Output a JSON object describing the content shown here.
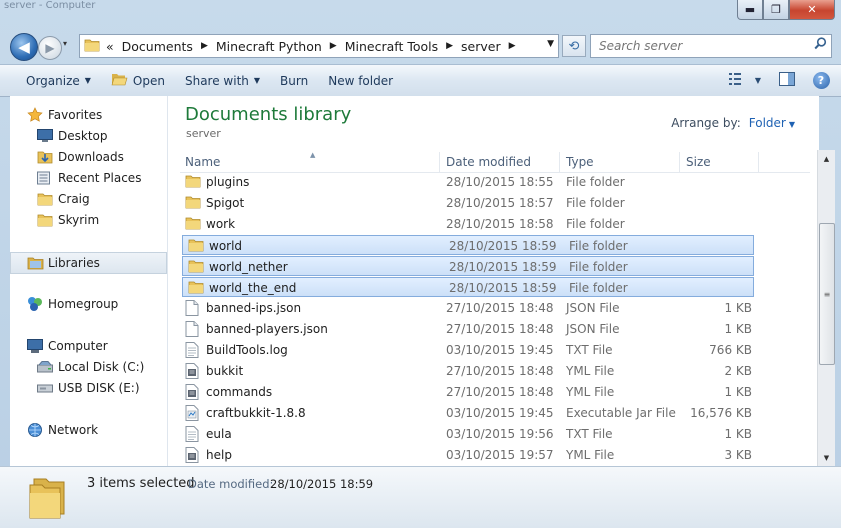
{
  "window": {
    "title": "server - Computer",
    "buttons": {
      "minimize": "▬",
      "maximize": "❐",
      "close": "✕"
    }
  },
  "nav": {
    "back_glyph": "◀",
    "forward_glyph": "▶",
    "history_glyph": "▾",
    "breadcrumb_prefix": "«",
    "breadcrumb": [
      "Documents",
      "Minecraft Python",
      "Minecraft Tools",
      "server"
    ],
    "refresh_glyph": "⟲",
    "search_placeholder": "Search server"
  },
  "toolbar": {
    "organize": "Organize",
    "open": "Open",
    "share_with": "Share with",
    "burn": "Burn",
    "new_folder": "New folder"
  },
  "sidebar": {
    "favorites": "Favorites",
    "favorites_items": [
      "Desktop",
      "Downloads",
      "Recent Places",
      "Craig",
      "Skyrim"
    ],
    "libraries": "Libraries",
    "homegroup": "Homegroup",
    "computer": "Computer",
    "computer_items": [
      "Local Disk (C:)",
      "USB DISK (E:)"
    ],
    "network": "Network"
  },
  "library": {
    "title": "Documents library",
    "subtitle": "server",
    "arrange_label": "Arrange by:",
    "arrange_value": "Folder"
  },
  "columns": {
    "name": "Name",
    "date": "Date modified",
    "type": "Type",
    "size": "Size"
  },
  "files": [
    {
      "name": "plugins",
      "date": "28/10/2015 18:55",
      "type": "File folder",
      "size": "",
      "icon": "folder-icon",
      "selected": false
    },
    {
      "name": "Spigot",
      "date": "28/10/2015 18:57",
      "type": "File folder",
      "size": "",
      "icon": "folder-icon",
      "selected": false
    },
    {
      "name": "work",
      "date": "28/10/2015 18:58",
      "type": "File folder",
      "size": "",
      "icon": "folder-icon",
      "selected": false
    },
    {
      "name": "world",
      "date": "28/10/2015 18:59",
      "type": "File folder",
      "size": "",
      "icon": "folder-icon",
      "selected": true
    },
    {
      "name": "world_nether",
      "date": "28/10/2015 18:59",
      "type": "File folder",
      "size": "",
      "icon": "folder-icon",
      "selected": true
    },
    {
      "name": "world_the_end",
      "date": "28/10/2015 18:59",
      "type": "File folder",
      "size": "",
      "icon": "folder-icon",
      "selected": true
    },
    {
      "name": "banned-ips.json",
      "date": "27/10/2015 18:48",
      "type": "JSON File",
      "size": "1 KB",
      "icon": "file-icon",
      "selected": false
    },
    {
      "name": "banned-players.json",
      "date": "27/10/2015 18:48",
      "type": "JSON File",
      "size": "1 KB",
      "icon": "file-icon",
      "selected": false
    },
    {
      "name": "BuildTools.log",
      "date": "03/10/2015 19:45",
      "type": "TXT File",
      "size": "766 KB",
      "icon": "text-file-icon",
      "selected": false
    },
    {
      "name": "bukkit",
      "date": "27/10/2015 18:48",
      "type": "YML File",
      "size": "2 KB",
      "icon": "yml-file-icon",
      "selected": false
    },
    {
      "name": "commands",
      "date": "27/10/2015 18:48",
      "type": "YML File",
      "size": "1 KB",
      "icon": "yml-file-icon",
      "selected": false
    },
    {
      "name": "craftbukkit-1.8.8",
      "date": "03/10/2015 19:45",
      "type": "Executable Jar File",
      "size": "16,576 KB",
      "icon": "jar-file-icon",
      "selected": false
    },
    {
      "name": "eula",
      "date": "03/10/2015 19:56",
      "type": "TXT File",
      "size": "1 KB",
      "icon": "text-file-icon",
      "selected": false
    },
    {
      "name": "help",
      "date": "03/10/2015 19:57",
      "type": "YML File",
      "size": "3 KB",
      "icon": "yml-file-icon",
      "selected": false
    }
  ],
  "details": {
    "count": "3 items selected",
    "date_label": "Date modified:",
    "date_value": "28/10/2015 18:59"
  },
  "scroll": {
    "up": "▲",
    "down": "▼",
    "grip": "≡"
  },
  "colors": {
    "accent": "#1e7a3a",
    "link": "#1f62b3",
    "selection": "#cce0f8"
  }
}
